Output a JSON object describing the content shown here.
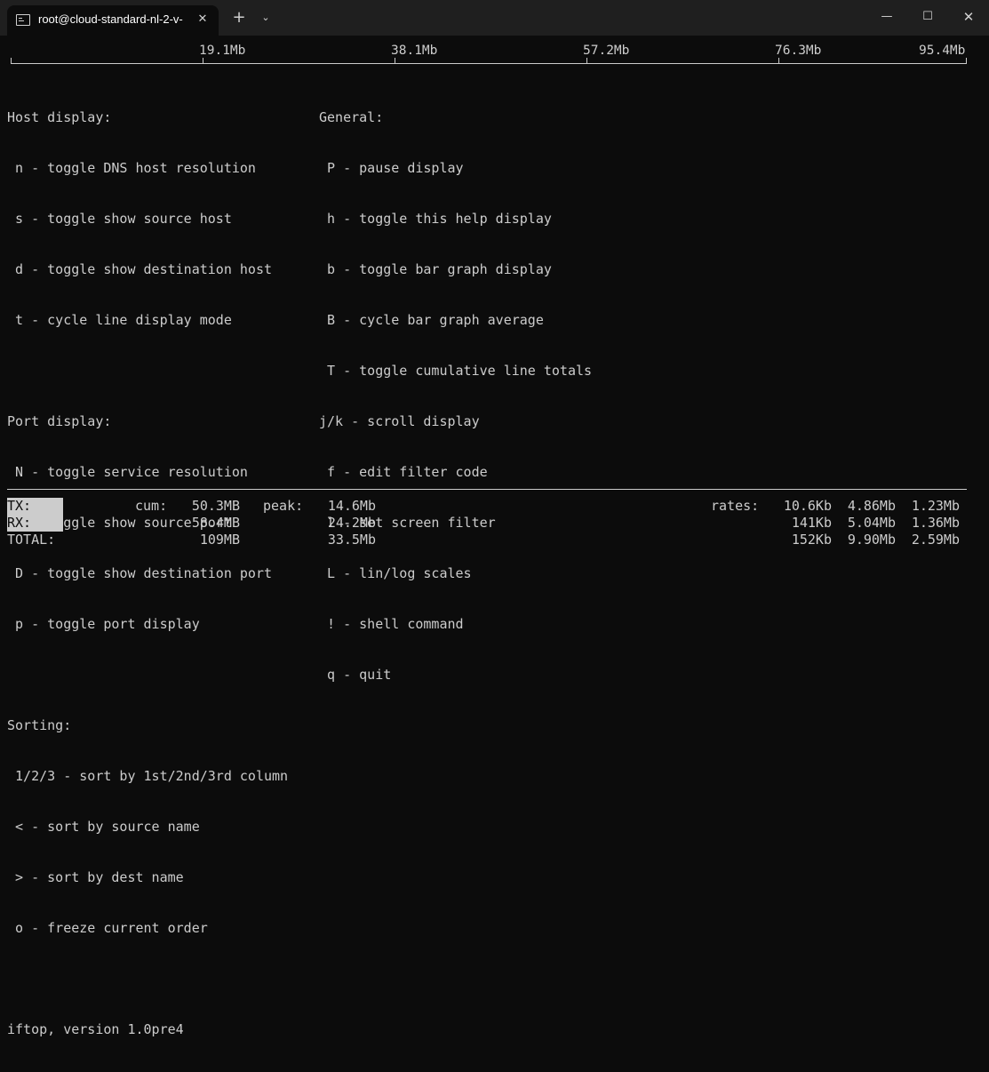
{
  "window": {
    "tab_title": "root@cloud-standard-nl-2-v-",
    "tab_close": "✕",
    "new_tab": "+",
    "dropdown": "⌄",
    "minimize": "—",
    "maximize": "☐",
    "close": "✕"
  },
  "scale": [
    "19.1Mb",
    "38.1Mb",
    "57.2Mb",
    "76.3Mb",
    "95.4Mb"
  ],
  "help_left": [
    "Host display:",
    " n - toggle DNS host resolution",
    " s - toggle show source host",
    " d - toggle show destination host",
    " t - cycle line display mode",
    "",
    "Port display:",
    " N - toggle service resolution",
    " S - toggle show source port",
    " D - toggle show destination port",
    " p - toggle port display",
    "",
    "Sorting:",
    " 1/2/3 - sort by 1st/2nd/3rd column",
    " < - sort by source name",
    " > - sort by dest name",
    " o - freeze current order",
    "",
    "iftop, version 1.0pre4"
  ],
  "help_right": [
    "General:",
    " P - pause display",
    " h - toggle this help display",
    " b - toggle bar graph display",
    " B - cycle bar graph average",
    " T - toggle cumulative line totals",
    "j/k - scroll display",
    " f - edit filter code",
    " l - set screen filter",
    " L - lin/log scales",
    " ! - shell command",
    " q - quit"
  ],
  "stats": {
    "tx_label": "TX:",
    "rx_label": "RX:",
    "total_label": "TOTAL:",
    "cum_label": "cum:",
    "peak_label": "peak:",
    "rates_label": "rates:",
    "tx_cum": "50.3MB",
    "rx_cum": "58.4MB",
    "total_cum": "109MB",
    "tx_peak": "14.6Mb",
    "rx_peak": "24.2Mb",
    "total_peak": "33.5Mb",
    "tx_rates": [
      "10.6Kb",
      "4.86Mb",
      "1.23Mb"
    ],
    "rx_rates": [
      "141Kb",
      "5.04Mb",
      "1.36Mb"
    ],
    "total_rates": [
      "152Kb",
      "9.90Mb",
      "2.59Mb"
    ]
  }
}
